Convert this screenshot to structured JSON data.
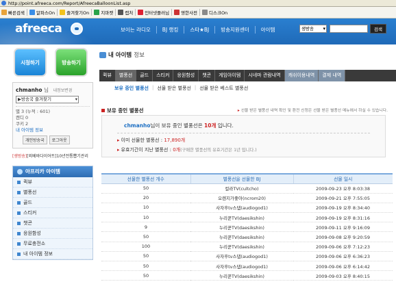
{
  "browser": {
    "url": "http://point.afreeca.com/Report/AfreecaBalloonList.asp",
    "bookmarks": [
      "빠른검색",
      "알파스On",
      "즐겨찾기On",
      "지마켓",
      "캡처",
      "인터넷플러님",
      "영한사전",
      "디스크On"
    ]
  },
  "header": {
    "logo": "afreeca",
    "nav": [
      "보이는 라디오",
      "BJ 랭킹",
      "스타★BJ",
      "방송지원센터",
      "아이템"
    ],
    "search_select": "생방송",
    "search_button": "검색"
  },
  "left": {
    "btn_watch": "시청하기",
    "btn_broadcast": "방송하기",
    "username": "chmanho",
    "user_suffix": "님",
    "user_info_link": "내정보변경",
    "fav_select": "▶방송국 즐겨찾기",
    "stats": [
      "별 3 (누적 : 601)",
      "캔디 0",
      "쿠키 2",
      "내 아이템 정보"
    ],
    "btn_mystation": "개인방송국",
    "btn_logout": "로그아웃",
    "promo_red": "[생방송]",
    "promo_text": "[외베바다이어트]10년전통뽑기관리",
    "item_menu_title": "아프리카 아이템",
    "item_menu": [
      "퀵뷰",
      "별풍선",
      "골드",
      "스티커",
      "챗콘",
      "응원함성",
      "무료충전소",
      "내 아이템 정보"
    ]
  },
  "main": {
    "title_bold": "내 아이템",
    "title_rest": "정보",
    "tabs": [
      "퀵뷰",
      "별풍선",
      "골드",
      "스티커",
      "응원함성",
      "챗콘",
      "게임아이템",
      "시네마 관람내역",
      "캐쉬이용내역",
      "결제 내역"
    ],
    "subtabs": [
      "보유 중인 별풍선",
      "선물 받은 별풍선",
      "선물 받은 베스트 별풍선"
    ],
    "section_title": "보유 중인 별풍선",
    "section_note": "선물 받은 별풍선 내역 확인 및 환전 신청은 선물 받은 별풍선 메뉴에서 하실 수 있습니다.",
    "summary": {
      "username": "chmanho",
      "line_mid": "님이 보유 중인 별풍선은",
      "count": "10개",
      "line_end": "입니다.",
      "gift_label": "이미 선물한 별풍선 :",
      "gift_value": "17,890개",
      "expired_label": "유효기간이 지난 별풍선 :",
      "expired_value": "0개",
      "expired_note": "(구매한 별풍선의 유효기간은 1년 입니다.)"
    },
    "table": {
      "headers": [
        "선물한 별풍선 개수",
        "별풍선을 선물한 BJ",
        "선물 일시"
      ],
      "rows": [
        [
          "50",
          "컬라TV(cultcho)",
          "2009-09-23 오후 8:03:38"
        ],
        [
          "20",
          "오렌지가좋아(ncrom20)",
          "2009-09-21 오후 7:55:05"
        ],
        [
          "10",
          "사자후tv스댑(audiogod1)",
          "2009-09-19 오후 8:34:40"
        ],
        [
          "10",
          "누리꾼TV(daesikshin)",
          "2009-09-19 오후 8:31:16"
        ],
        [
          "9",
          "누리꾼TV(daesikshin)",
          "2009-09-11 오후 9:16:09"
        ],
        [
          "50",
          "누리꾼TV(daesikshin)",
          "2009-09-08 오후 9:20:59"
        ],
        [
          "100",
          "누리꾼TV(daesikshin)",
          "2009-09-06 오후 7:12:23"
        ],
        [
          "50",
          "사자후tv스댑(audiogod1)",
          "2009-09-06 오후 6:36:23"
        ],
        [
          "50",
          "사자후tv스댑(audiogod1)",
          "2009-09-06 오후 6:14:42"
        ],
        [
          "50",
          "누리꾼TV(daesikshin)",
          "2009-09-03 오후 8:40:15"
        ]
      ]
    }
  }
}
